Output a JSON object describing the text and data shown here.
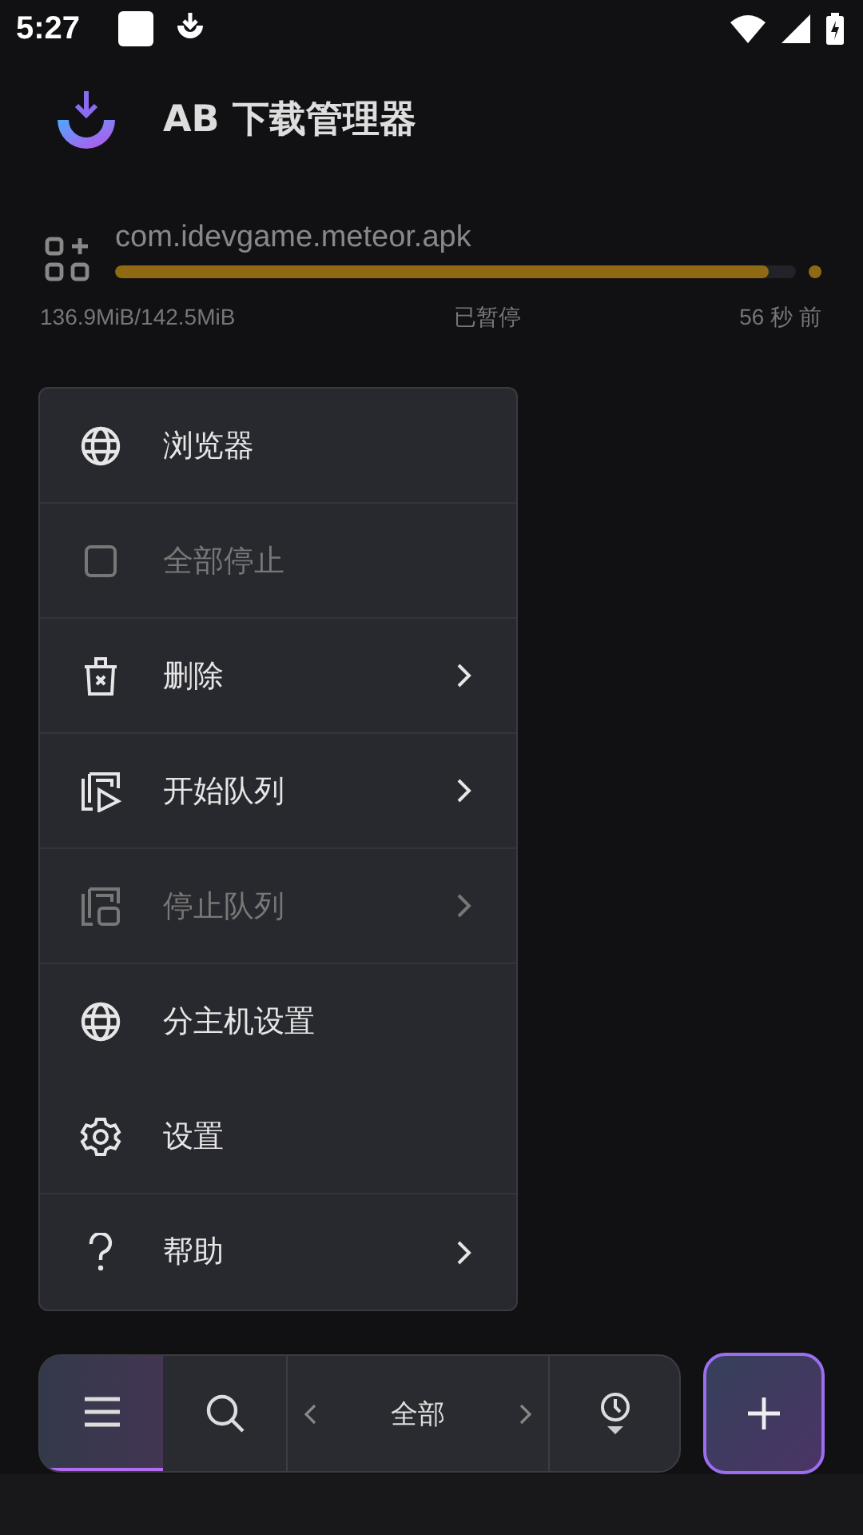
{
  "status_bar": {
    "time": "5:27"
  },
  "app_bar": {
    "title": "AB 下载管理器"
  },
  "download": {
    "file_name": "com.idevgame.meteor.apk",
    "level": 0.96,
    "size": "136.9MiB/142.5MiB",
    "status": "已暂停",
    "time": "56 秒 前"
  },
  "menu": {
    "items": [
      {
        "kind": "globe",
        "label": "浏览器",
        "disabled": false,
        "submenu": false,
        "divider_after": true
      },
      {
        "kind": "square",
        "label": "全部停止",
        "disabled": true,
        "submenu": false,
        "divider_after": true
      },
      {
        "kind": "trash",
        "label": "删除",
        "disabled": false,
        "submenu": true,
        "divider_after": true
      },
      {
        "kind": "queue-start",
        "label": "开始队列",
        "disabled": false,
        "submenu": true,
        "divider_after": true
      },
      {
        "kind": "queue-stop",
        "label": "停止队列",
        "disabled": true,
        "submenu": true,
        "divider_after": true
      },
      {
        "kind": "globe",
        "label": "分主机设置",
        "disabled": false,
        "submenu": false,
        "divider_after": false
      },
      {
        "kind": "gear",
        "label": "设置",
        "disabled": false,
        "submenu": false,
        "divider_after": true
      },
      {
        "kind": "help",
        "label": "帮助",
        "disabled": false,
        "submenu": true,
        "divider_after": false
      }
    ]
  },
  "bottom_bar": {
    "menu_selected": true,
    "category": "全部"
  }
}
